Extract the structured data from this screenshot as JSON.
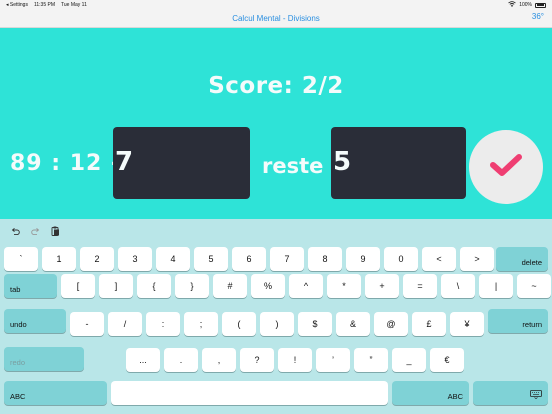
{
  "status": {
    "carrier": "◂ Settings",
    "time": "11:35 PM",
    "date": "Tue May 11",
    "battery": "100%"
  },
  "nav": {
    "title": "Calcul Mental - Divisions",
    "angle": "36°"
  },
  "game": {
    "score": "Score: 2/2",
    "question": "89 : 12 ->",
    "quotient_value": "7",
    "remainder_label": "reste",
    "remainder_value": "5"
  },
  "colors": {
    "main_bg": "#2ee3d7",
    "box": "#2a2d38",
    "check": "#ef3e72",
    "keyboard": "#b9e6e8",
    "special_key": "#7fd2d6"
  },
  "icons": {
    "undo": "undo-icon",
    "redo": "redo-icon",
    "paste": "clipboard-icon",
    "check": "checkmark-icon",
    "hide": "keyboard-icon"
  },
  "keyboard": {
    "row1": [
      "`",
      "1",
      "2",
      "3",
      "4",
      "5",
      "6",
      "7",
      "8",
      "9",
      "0",
      "<",
      ">"
    ],
    "row1_action": "delete",
    "row2_action": "tab",
    "row2": [
      "[",
      "]",
      "{",
      "}",
      "#",
      "%",
      "^",
      "*",
      "+",
      "=",
      "\\",
      "|",
      "~"
    ],
    "row3_action": "undo",
    "row3": [
      "-",
      "/",
      ":",
      ";",
      "(",
      ")",
      "$",
      "&",
      "@",
      "£",
      "¥"
    ],
    "row3_return": "return",
    "row4_action": "redo",
    "row4": [
      "...",
      ".",
      ",",
      "?",
      "!",
      "’",
      "”",
      "_",
      "€"
    ],
    "row5_left": "ABC",
    "row5_right": "ABC"
  }
}
